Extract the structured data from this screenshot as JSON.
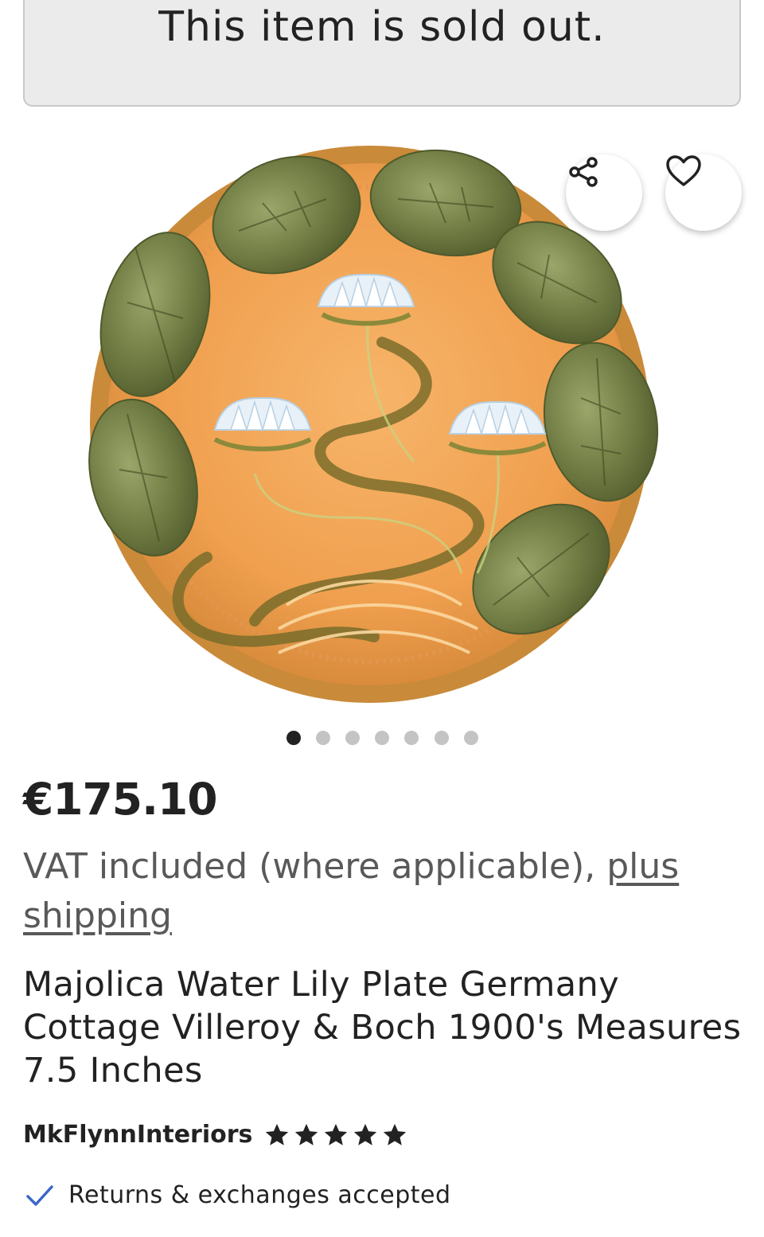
{
  "banner": {
    "sold_out_text": "This item is sold out."
  },
  "gallery": {
    "image_description": "majolica-water-lily-plate-photo",
    "dot_count": 7,
    "active_index": 0,
    "share_icon": "share-icon",
    "favorite_icon": "heart-icon"
  },
  "listing": {
    "price": "€175.10",
    "vat_text": "VAT included (where applicable), ",
    "shipping_link": "plus shipping",
    "title": "Majolica Water Lily Plate Germany Cottage Villeroy & Boch 1900's Measures 7.5 Inches",
    "shop_name": "MkFlynnInteriors",
    "rating": 5,
    "rating_max": 5,
    "returns_text": "Returns & exchanges accepted"
  },
  "colors": {
    "text": "#222222",
    "muted": "#595959",
    "accent_check": "#3b67c8",
    "plate_orange": "#f2a85a",
    "leaf_green": "#6e7a45"
  }
}
